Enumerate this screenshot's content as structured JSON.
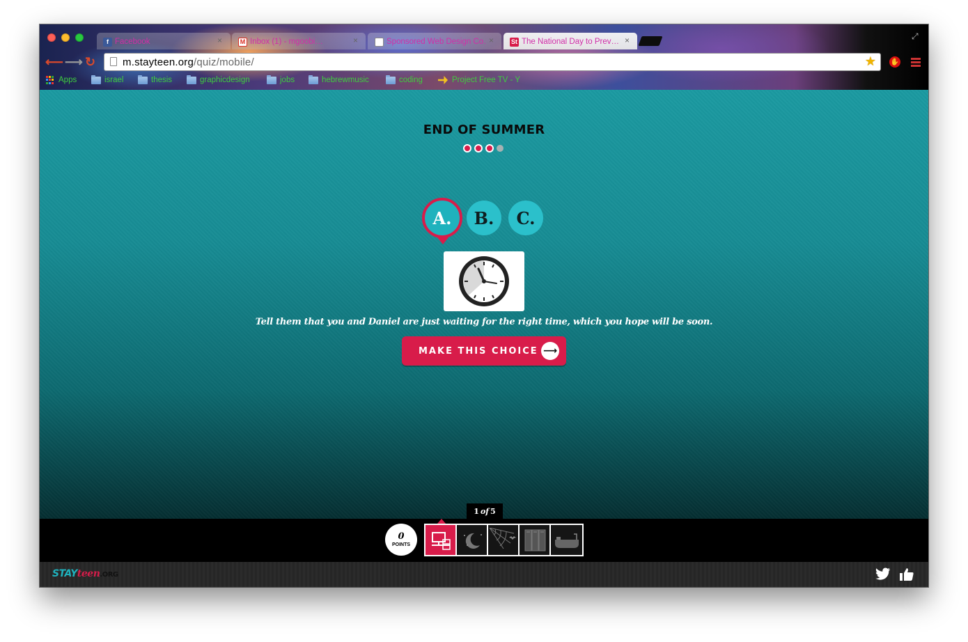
{
  "browser": {
    "tabs": [
      {
        "title": "Facebook",
        "favicon": "facebook-icon",
        "active": false
      },
      {
        "title": "Inbox (1) - mgoobi…",
        "favicon": "gmail-icon",
        "active": false
      },
      {
        "title": "Sponsored Web Design Co…",
        "favicon": "document-icon",
        "active": false
      },
      {
        "title": "The National Day to Prev…",
        "favicon": "stayteen-icon",
        "active": true
      }
    ],
    "tab_close_glyph": "×",
    "url_host": "m.stayteen.org",
    "url_path": "/quiz/mobile/",
    "bookmarks": [
      {
        "label": "Apps",
        "icon": "apps-grid-icon"
      },
      {
        "label": "israel",
        "icon": "folder-icon"
      },
      {
        "label": "thesis",
        "icon": "folder-icon"
      },
      {
        "label": "graphicdesign",
        "icon": "folder-icon"
      },
      {
        "label": "jobs",
        "icon": "folder-icon"
      },
      {
        "label": "hebrewmusic",
        "icon": "folder-icon"
      },
      {
        "label": "coding",
        "icon": "folder-icon"
      },
      {
        "label": "Project Free TV - Y",
        "icon": "project-free-tv-icon"
      }
    ]
  },
  "quiz": {
    "title": "END OF SUMMER",
    "progress": {
      "completed": 3,
      "total": 4
    },
    "choices": [
      {
        "letter": "A.",
        "selected": true
      },
      {
        "letter": "B.",
        "selected": false
      },
      {
        "letter": "C.",
        "selected": false
      }
    ],
    "selected_illustration": "clock-icon",
    "answer_text": "Tell them that you and Daniel are just waiting for the right time, which you hope will be soon.",
    "cta_label": "MAKE THIS CHOICE",
    "cta_icon": "arrow-right-icon",
    "step": {
      "current": "1",
      "of": "of",
      "total": "5"
    }
  },
  "scoreboard": {
    "points_value": "0",
    "points_label": "POINTS",
    "scenes": [
      {
        "icon": "computer-desk-icon",
        "current": true
      },
      {
        "icon": "moon-night-icon",
        "current": false
      },
      {
        "icon": "spiderweb-bats-icon",
        "current": false
      },
      {
        "icon": "lockers-icon",
        "current": false
      },
      {
        "icon": "bathtub-icon",
        "current": false
      }
    ]
  },
  "footer": {
    "logo_stay": "STAY",
    "logo_teen": "teen",
    "logo_org": ".ORG",
    "social": [
      "twitter-icon",
      "thumbs-up-icon"
    ]
  },
  "colors": {
    "accent": "#d81c4a",
    "teal": "#1fb2bd",
    "link_green": "#3fcf3f",
    "tab_text_pink": "#d12ea8"
  }
}
